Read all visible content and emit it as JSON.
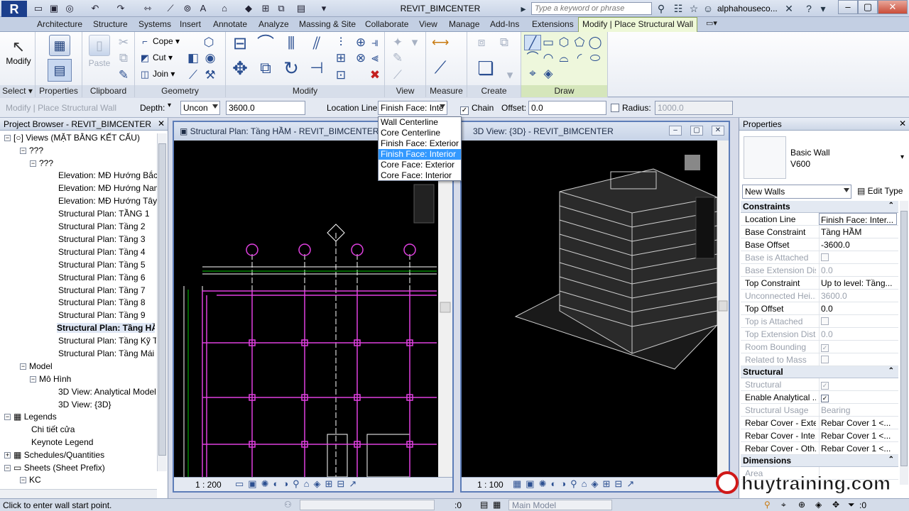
{
  "app": {
    "title": "REVIT_BIMCENTER",
    "logo": "R"
  },
  "search": {
    "placeholder": "Type a keyword or phrase"
  },
  "user": {
    "name": "alphahouseco..."
  },
  "tabs": [
    "Architecture",
    "Structure",
    "Systems",
    "Insert",
    "Annotate",
    "Analyze",
    "Massing & Site",
    "Collaborate",
    "View",
    "Manage",
    "Add-Ins",
    "Extensions",
    "Modify | Place Structural Wall"
  ],
  "ribbon": {
    "select": {
      "modify": "Modify",
      "title": "Select"
    },
    "properties": {
      "label": "Properties",
      "title": "Properties"
    },
    "clipboard": {
      "paste": "Paste",
      "title": "Clipboard"
    },
    "geometry": {
      "cope": "Cope",
      "cut": "Cut",
      "join": "Join",
      "title": "Geometry"
    },
    "modify_title": "Modify",
    "view_title": "View",
    "measure_title": "Measure",
    "create_title": "Create",
    "draw_title": "Draw"
  },
  "options": {
    "context": "Modify | Place Structural Wall",
    "depth_label": "Depth:",
    "depth_value": "Uncon",
    "height_value": "3600.0",
    "location_label": "Location Line:",
    "location_value": "Finish Face: Inte",
    "chain_label": "Chain",
    "offset_label": "Offset:",
    "offset_value": "0.0",
    "radius_label": "Radius:",
    "radius_value": "1000.0"
  },
  "dropdown": {
    "items": [
      "Wall Centerline",
      "Core Centerline",
      "Finish Face: Exterior",
      "Finish Face: Interior",
      "Core Face: Exterior",
      "Core Face: Interior"
    ],
    "selected_index": 3
  },
  "project_browser": {
    "title": "Project Browser - REVIT_BIMCENTER",
    "items": [
      "Views (MẶT BẰNG KẾT CẤU)",
      "???",
      "???",
      "Elevation: MĐ Hướng Bắc",
      "Elevation: MĐ Hướng Nam",
      "Elevation: MĐ Hướng Tây",
      "Structural Plan: TẦNG 1",
      "Structural Plan: Tầng 2",
      "Structural Plan: Tầng 3",
      "Structural Plan: Tầng 4",
      "Structural Plan: Tầng 5",
      "Structural Plan: Tầng 6",
      "Structural Plan: Tầng 7",
      "Structural Plan: Tầng 8",
      "Structural Plan: Tầng 9",
      "Structural Plan: Tầng HẦM",
      "Structural Plan: Tầng Kỹ Thu",
      "Structural Plan: Tầng Mái",
      "Model",
      "Mô Hình",
      "3D View: Analytical Model",
      "3D View: {3D}",
      "Legends",
      "Chi tiết cửa",
      "Keynote Legend",
      "Schedules/Quantities",
      "Sheets (Sheet Prefix)",
      "KC"
    ],
    "selected_index": 15
  },
  "plan_view": {
    "title": "Structural Plan: Tầng HẦM - REVIT_BIMCENTER",
    "scale": "1 : 200"
  },
  "view3d": {
    "title": "3D View: {3D} - REVIT_BIMCENTER",
    "scale": "1 : 100"
  },
  "properties": {
    "title": "Properties",
    "type_family": "Basic Wall",
    "type_name": "V600",
    "instance_selector": "New Walls",
    "edit_type": "Edit Type",
    "groups": {
      "constraints": "Constraints",
      "structural": "Structural",
      "dimensions": "Dimensions"
    },
    "rows": [
      {
        "k": "Location Line",
        "v": "Finish Face: Inter..."
      },
      {
        "k": "Base Constraint",
        "v": "Tầng HẦM"
      },
      {
        "k": "Base Offset",
        "v": "-3600.0"
      },
      {
        "k": "Base is Attached",
        "v": ""
      },
      {
        "k": "Base Extension Dis...",
        "v": "0.0"
      },
      {
        "k": "Top Constraint",
        "v": "Up to level: Tầng..."
      },
      {
        "k": "Unconnected Hei...",
        "v": "3600.0"
      },
      {
        "k": "Top Offset",
        "v": "0.0"
      },
      {
        "k": "Top is Attached",
        "v": ""
      },
      {
        "k": "Top Extension Dist...",
        "v": "0.0"
      },
      {
        "k": "Room Bounding",
        "v": ""
      },
      {
        "k": "Related to Mass",
        "v": ""
      },
      {
        "k": "Structural",
        "v": ""
      },
      {
        "k": "Enable Analytical ...",
        "v": ""
      },
      {
        "k": "Structural Usage",
        "v": "Bearing"
      },
      {
        "k": "Rebar Cover - Exte...",
        "v": "Rebar Cover 1 <..."
      },
      {
        "k": "Rebar Cover - Inte...",
        "v": "Rebar Cover 1 <..."
      },
      {
        "k": "Rebar Cover - Oth...",
        "v": "Rebar Cover 1 <..."
      },
      {
        "k": "Area",
        "v": ""
      }
    ]
  },
  "status": {
    "hint": "Click to enter wall start point.",
    "coord": ":0",
    "model": "Main Model",
    "filter": ":0"
  },
  "watermark": "huytraining.com",
  "colors": {
    "ribbon_context": "#eef8d8",
    "selection": "#3399ff",
    "grid_magenta": "#e040e0",
    "canvas": "#000000"
  }
}
